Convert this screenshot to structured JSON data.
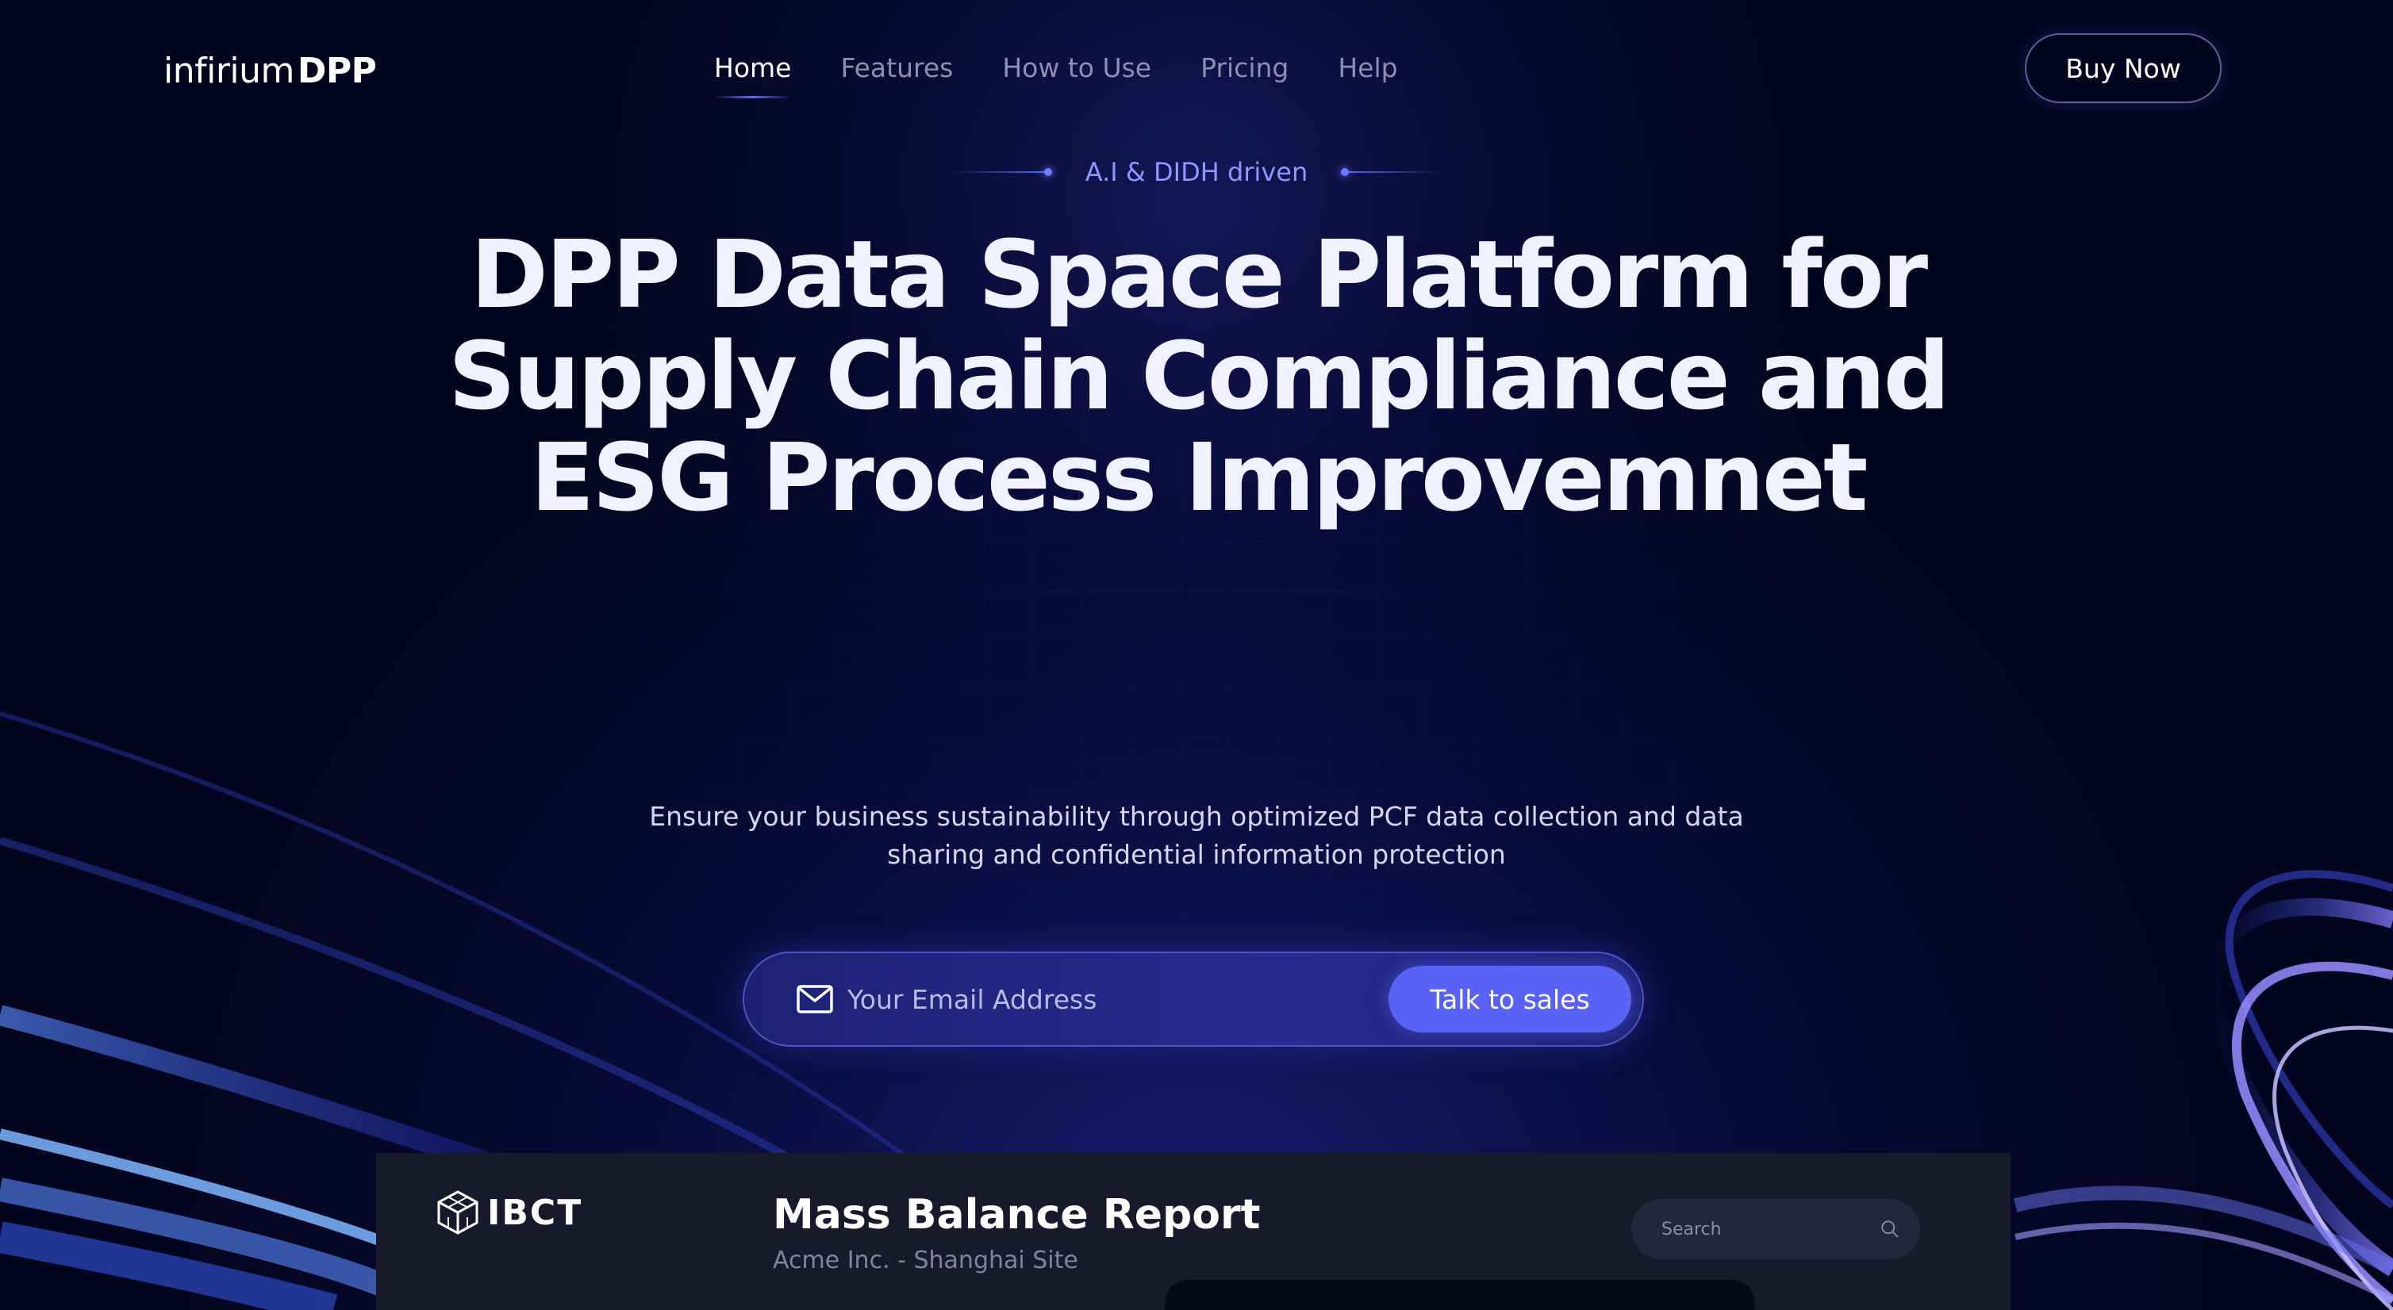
{
  "brand": {
    "logo_light": "infirium",
    "logo_bold": "DPP"
  },
  "nav": {
    "items": [
      {
        "label": "Home",
        "active": true
      },
      {
        "label": "Features",
        "active": false
      },
      {
        "label": "How to Use",
        "active": false
      },
      {
        "label": "Pricing",
        "active": false
      },
      {
        "label": "Help",
        "active": false
      }
    ],
    "cta_label": "Buy Now"
  },
  "hero": {
    "tagline": "A.I & DIDH driven",
    "title": "DPP Data Space Platform for Supply Chain Compliance and ESG Process Improvemnet",
    "subtitle": "Ensure your business sustainability through optimized PCF data collection and data sharing and confidential information protection",
    "email_placeholder": "Your Email Address",
    "email_value": "",
    "submit_label": "Talk to sales"
  },
  "preview": {
    "logo_text": "IBCT",
    "title": "Mass Balance Report",
    "subtitle": "Acme Inc. - Shanghai Site",
    "search_placeholder": "Search"
  },
  "icons": {
    "mail": "mail-icon",
    "search": "search-icon",
    "cube_logo": "cube-logo-icon"
  },
  "colors": {
    "background": "#03051f",
    "accent": "#5962f5",
    "accent_text": "#8e97ff",
    "nav_inactive": "#8b8fb3",
    "panel": "#181a2c"
  }
}
